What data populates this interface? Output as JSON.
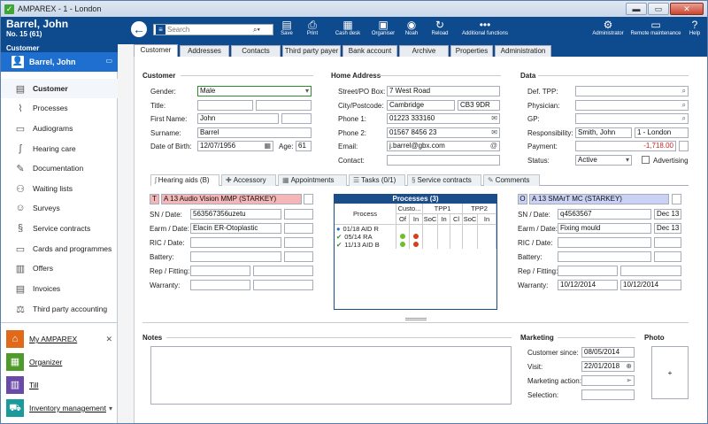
{
  "window": {
    "title": "AMPAREX - 1 - London",
    "min": "▬",
    "max": "▭",
    "close": "✕"
  },
  "header": {
    "customer_name": "Barrel, John",
    "customer_no": "No. 15 (61)",
    "context": "Customer",
    "search_placeholder": "Search",
    "toolbar": [
      {
        "label": "Save",
        "icon": "save-icon"
      },
      {
        "label": "Print",
        "icon": "print-icon"
      },
      {
        "label": "Cash desk",
        "icon": "cashdesk-icon"
      },
      {
        "label": "Organiser",
        "icon": "organiser-icon"
      },
      {
        "label": "Noah",
        "icon": "noah-icon"
      },
      {
        "label": "Reload",
        "icon": "reload-icon"
      },
      {
        "label": "Additional functions",
        "icon": "more-icon"
      }
    ],
    "right_toolbar": [
      {
        "label": "Administrator",
        "icon": "admin-icon"
      },
      {
        "label": "Remote maintenance",
        "icon": "remote-icon"
      },
      {
        "label": "Help",
        "icon": "help-icon"
      }
    ]
  },
  "sidebar": {
    "caption": "Customer",
    "active_record": "Barrel, John",
    "items": [
      {
        "label": "Customer",
        "icon": "customer-card-icon",
        "selected": true
      },
      {
        "label": "Processes",
        "icon": "paperclip-icon"
      },
      {
        "label": "Audiograms",
        "icon": "audiogram-icon"
      },
      {
        "label": "Hearing care",
        "icon": "ear-icon"
      },
      {
        "label": "Documentation",
        "icon": "pen-icon"
      },
      {
        "label": "Waiting lists",
        "icon": "people-icon"
      },
      {
        "label": "Surveys",
        "icon": "survey-icon"
      },
      {
        "label": "Service contracts",
        "icon": "paragraph-icon"
      },
      {
        "label": "Cards and programmes",
        "icon": "card-icon"
      },
      {
        "label": "Offers",
        "icon": "offers-icon"
      },
      {
        "label": "Invoices",
        "icon": "invoice-icon"
      },
      {
        "label": "Third party accounting",
        "icon": "scales-icon"
      }
    ],
    "modules": [
      {
        "label": "My AMPAREX",
        "color": "#e06a1a",
        "icon": "home-icon"
      },
      {
        "label": "Organizer",
        "color": "#4e9a2a",
        "icon": "calendar-icon"
      },
      {
        "label": "Till",
        "color": "#6a4aa8",
        "icon": "till-icon"
      },
      {
        "label": "Inventory management",
        "color": "#1a9a9a",
        "icon": "cart-icon"
      }
    ]
  },
  "tabs": [
    "Customer",
    "Addresses",
    "Contacts",
    "Third party payer",
    "Bank account",
    "Archive",
    "Properties",
    "Administration"
  ],
  "customer": {
    "section": "Customer",
    "gender_label": "Gender:",
    "gender": "Male",
    "title_label": "Title:",
    "first_name_label": "First Name:",
    "first_name": "John",
    "surname_label": "Surname:",
    "surname": "Barrel",
    "dob_label": "Date of Birth:",
    "dob": "12/07/1956",
    "age_label": "Age:",
    "age": "61"
  },
  "home_address": {
    "section": "Home Address",
    "street_label": "Street/PO Box:",
    "street": "7 West Road",
    "city_label": "City/Postcode:",
    "city": "Cambridge",
    "postcode": "CB3 9DR",
    "phone1_label": "Phone 1:",
    "phone1": "01223 333160",
    "phone2_label": "Phone 2:",
    "phone2": "01567 8456 23",
    "email_label": "Email:",
    "email": "j.barrel@gbx.com",
    "contact_label": "Contact:"
  },
  "data": {
    "section": "Data",
    "def_tpp_label": "Def. TPP:",
    "physician_label": "Physician:",
    "gp_label": "GP:",
    "responsibility_label": "Responsibility:",
    "responsibility": "Smith, John",
    "branch": "1 - London",
    "payment_label": "Payment:",
    "payment": "-1,718.00",
    "status_label": "Status:",
    "status": "Active",
    "advertising_label": "Advertising"
  },
  "subtabs": [
    "Hearing aids (B)",
    "Accessory",
    "Appointments",
    "Tasks (0/1)",
    "Service contracts",
    "Comments"
  ],
  "left_aid": {
    "side": "T",
    "model": "A 13 Audio Vision MMP (STARKEY)",
    "sn_label": "SN / Date:",
    "sn": "563567356uzetu",
    "earm_label": "Earm / Date:",
    "earm": "Elacin ER-Otoplastic",
    "ric_label": "RIC / Date:",
    "battery_label": "Battery:",
    "rep_label": "Rep / Fitting:",
    "warranty_label": "Warranty:"
  },
  "right_aid": {
    "side": "O",
    "model": "A 13 SMArT MC (STARKEY)",
    "sn_label": "SN / Date:",
    "sn": "q4563567",
    "sn_date": "Dec 13",
    "earm_label": "Earm / Date:",
    "earm": "Fixing mould",
    "earm_date": "Dec 13",
    "ric_label": "RIC / Date:",
    "battery_label": "Battery:",
    "rep_label": "Rep / Fitting:",
    "warranty_label": "Warranty:",
    "warranty1": "10/12/2014",
    "warranty2": "10/12/2014"
  },
  "processes": {
    "title": "Processes (3)",
    "col_process": "Process",
    "grp_cust": "Custo...",
    "grp_tpp1": "TPP1",
    "grp_tpp2": "TPP2",
    "sub": [
      "Of",
      "In",
      "SoC",
      "In",
      "Cl",
      "SoC",
      "In"
    ],
    "rows": [
      {
        "name": "01/18 AID R",
        "mark": "●",
        "mark_color": "#1a66cc",
        "of": "",
        "in": ""
      },
      {
        "name": "05/14 RA",
        "mark": "✔",
        "mark_color": "#2e8b2e",
        "of": "#6ac12b",
        "in": "#d8401c"
      },
      {
        "name": "11/13 AID B",
        "mark": "✔",
        "mark_color": "#2e8b2e",
        "of": "#6ac12b",
        "in": "#d8401c"
      }
    ]
  },
  "notes": {
    "section": "Notes"
  },
  "marketing": {
    "section": "Marketing",
    "since_label": "Customer since:",
    "since": "08/05/2014",
    "visit_label": "Visit:",
    "visit": "22/01/2018",
    "action_label": "Marketing action:",
    "selection_label": "Selection:"
  },
  "photo": {
    "section": "Photo",
    "add": "+"
  }
}
